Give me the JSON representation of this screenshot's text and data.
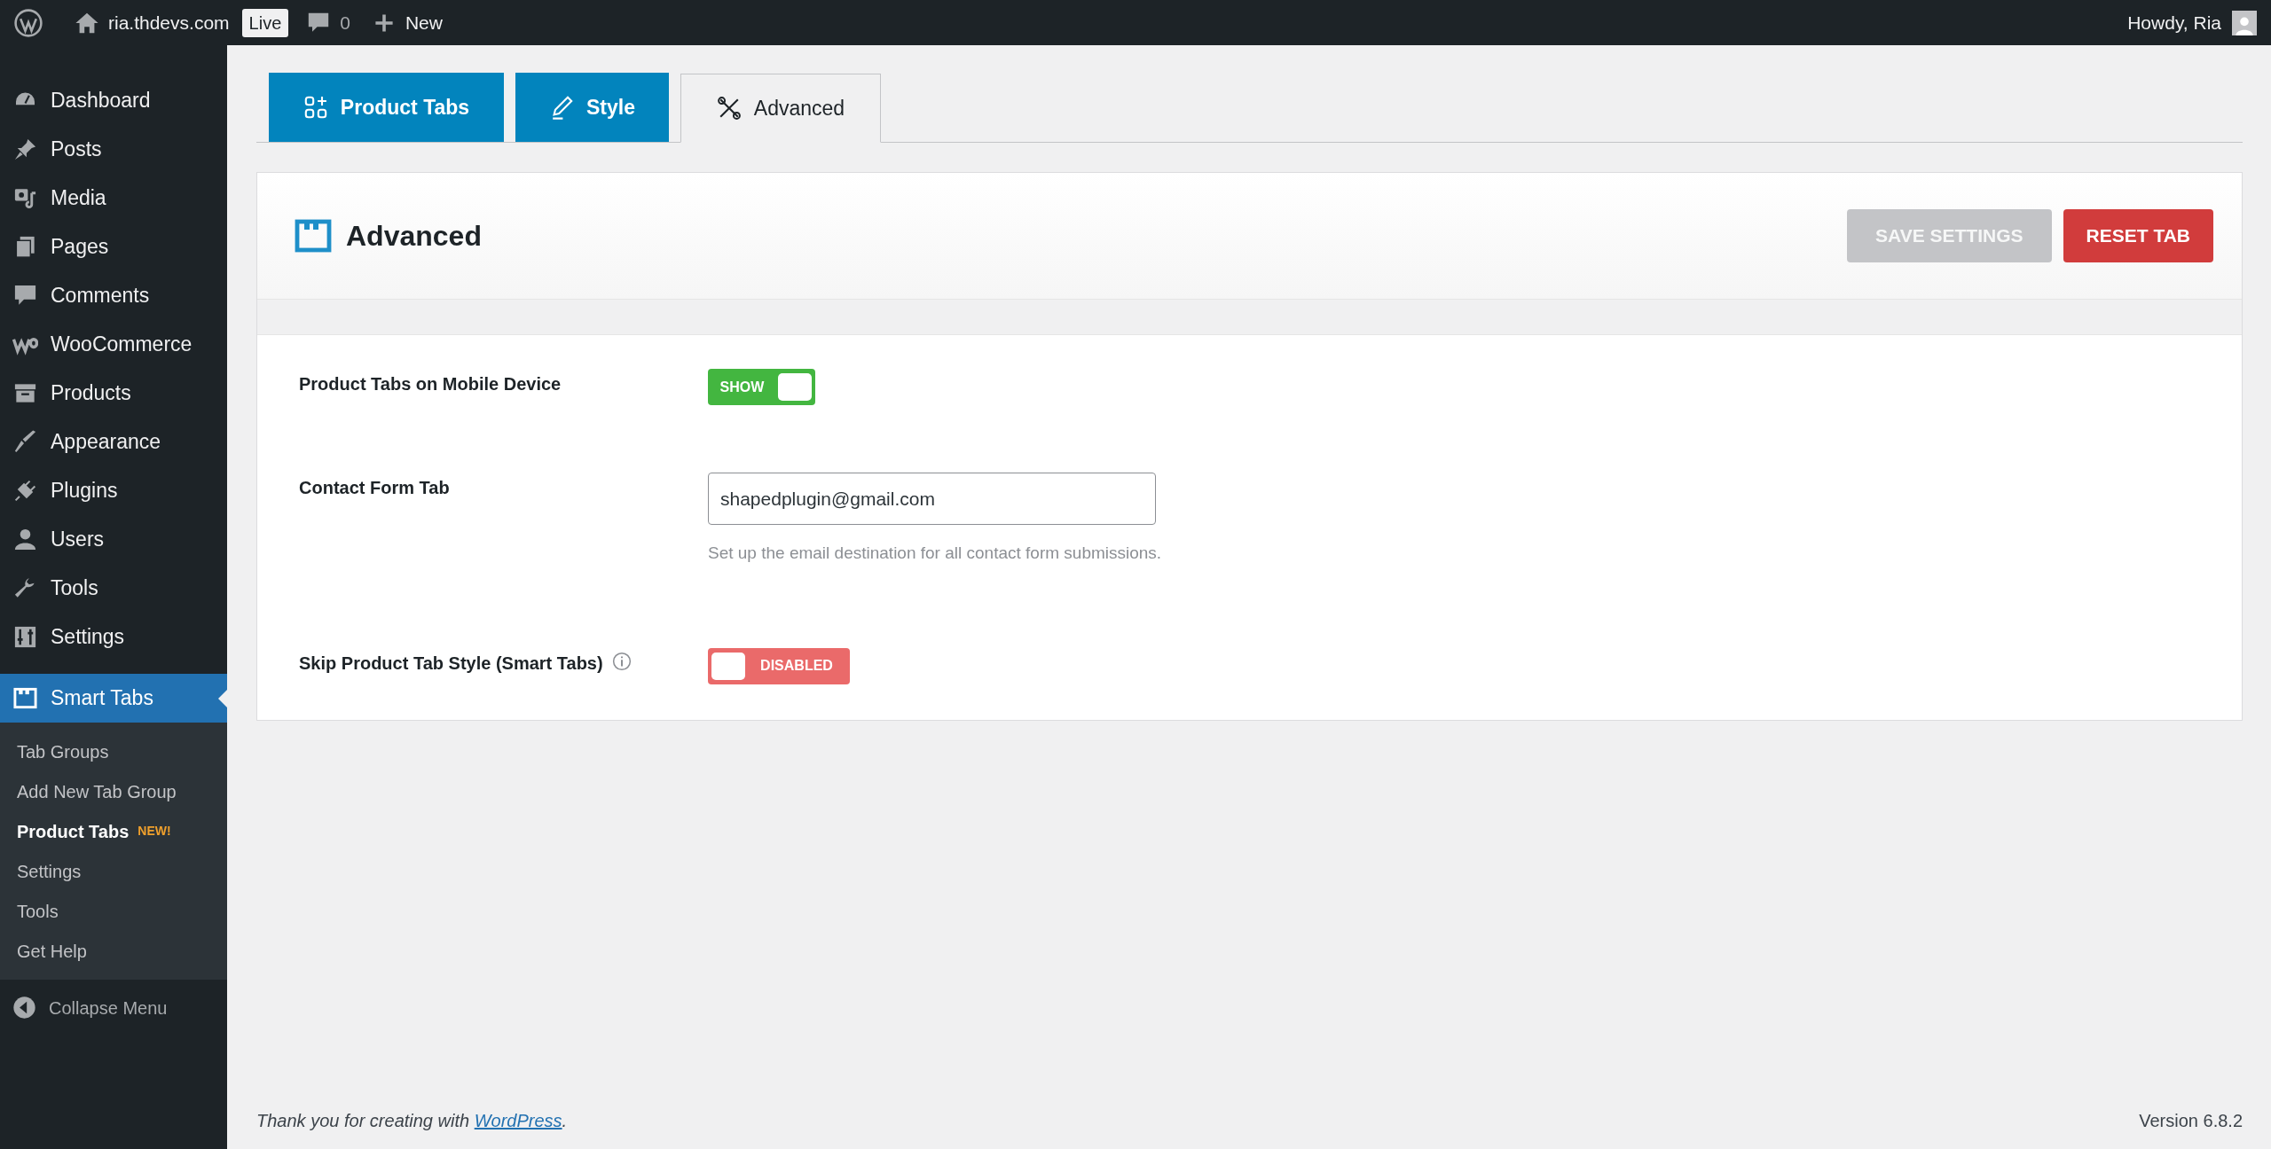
{
  "admin_bar": {
    "site": "ria.thdevs.com",
    "badge": "Live",
    "comments": "0",
    "new": "New",
    "greeting": "Howdy, Ria"
  },
  "sidebar": {
    "items": [
      {
        "label": "Dashboard",
        "selected": false
      },
      {
        "label": "Posts",
        "selected": false
      },
      {
        "label": "Media",
        "selected": false
      },
      {
        "label": "Pages",
        "selected": false
      },
      {
        "label": "Comments",
        "selected": false
      },
      {
        "label": "WooCommerce",
        "selected": false
      },
      {
        "label": "Products",
        "selected": false
      },
      {
        "label": "Appearance",
        "selected": false
      },
      {
        "label": "Plugins",
        "selected": false
      },
      {
        "label": "Users",
        "selected": false
      },
      {
        "label": "Tools",
        "selected": false
      },
      {
        "label": "Settings",
        "selected": false
      },
      {
        "label": "Smart Tabs",
        "selected": true
      }
    ],
    "submenu": [
      {
        "label": "Tab Groups",
        "selected": false
      },
      {
        "label": "Add New Tab Group",
        "selected": false
      },
      {
        "label": "Product Tabs",
        "selected": true,
        "badge": "NEW!"
      },
      {
        "label": "Settings",
        "selected": false
      },
      {
        "label": "Tools",
        "selected": false
      },
      {
        "label": "Get Help",
        "selected": false
      }
    ],
    "collapse": "Collapse Menu"
  },
  "tabs": [
    {
      "label": "Product Tabs",
      "selected": false
    },
    {
      "label": "Style",
      "selected": false
    },
    {
      "label": "Advanced",
      "selected": true
    }
  ],
  "panel": {
    "title": "Advanced",
    "buttons": [
      {
        "label": "SAVE SETTINGS",
        "kind": "save",
        "disabled": true
      },
      {
        "label": "RESET TAB",
        "kind": "reset",
        "disabled": false
      }
    ],
    "fields": [
      {
        "kind": "toggle",
        "label": "Product Tabs on Mobile Device",
        "on": true,
        "text": "SHOW",
        "info": false
      },
      {
        "kind": "input",
        "label": "Contact Form Tab",
        "value": "shapedplugin@gmail.com",
        "help": "Set up the email destination for all contact form submissions."
      },
      {
        "kind": "toggle",
        "label": "Skip Product Tab Style (Smart Tabs)",
        "on": false,
        "text": "DISABLED",
        "info": true
      }
    ]
  },
  "footer": {
    "text": "Thank you for creating with ",
    "link": "WordPress",
    "after": ".",
    "version": "Version 6.8.2"
  }
}
